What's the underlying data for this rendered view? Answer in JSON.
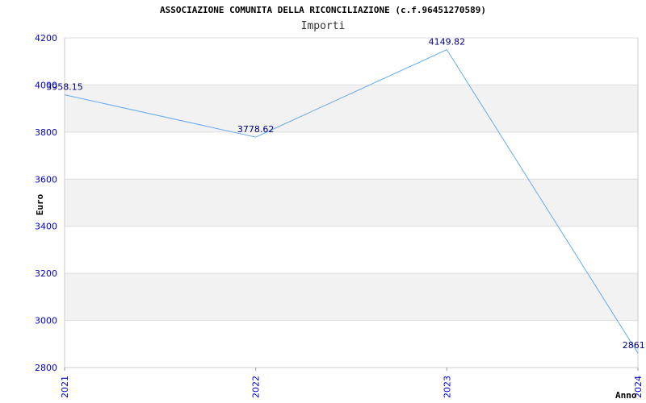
{
  "chart_data": {
    "type": "line",
    "title": "ASSOCIAZIONE COMUNITA DELLA RICONCILIAZIONE (c.f.96451270589)",
    "subtitle": "Importi",
    "xlabel": "Anno",
    "ylabel": "Euro",
    "categories": [
      "2021",
      "2022",
      "2023",
      "2024"
    ],
    "values": [
      3958.15,
      3778.62,
      4149.82,
      2861.0
    ],
    "data_labels": [
      "3958.15",
      "3778.62",
      "4149.82",
      "2861.0"
    ],
    "yticks": [
      "2800",
      "3000",
      "3200",
      "3400",
      "3600",
      "3800",
      "4000",
      "4200"
    ],
    "ylim": [
      2800,
      4200
    ],
    "grid": true,
    "line_color": "#66aaee",
    "band_color": "#f2f2f2",
    "tick_color": "#0000cc",
    "label_color": "#000080"
  }
}
